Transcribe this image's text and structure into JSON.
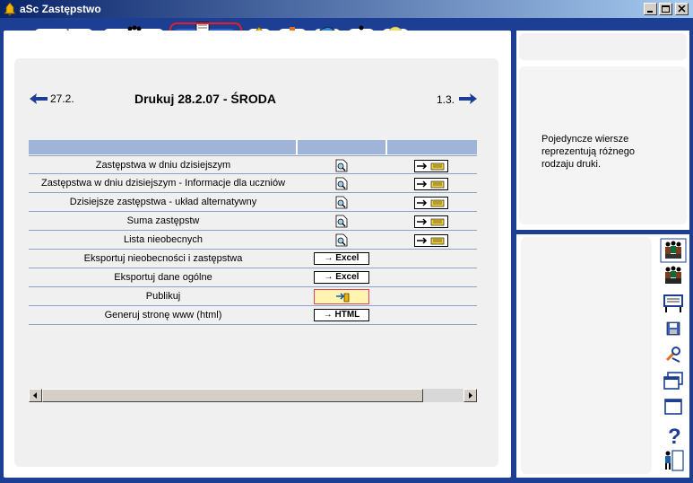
{
  "window": {
    "title": "aSc Zastępstwo"
  },
  "tabs": [
    {
      "name": "sleep",
      "icon": "sleep-icon"
    },
    {
      "name": "teachers",
      "icon": "teachers-icon"
    },
    {
      "name": "print",
      "icon": "printer-icon"
    },
    {
      "name": "bell",
      "icon": "bell-icon"
    },
    {
      "name": "desk",
      "icon": "desk-icon"
    },
    {
      "name": "book",
      "icon": "book-icon"
    },
    {
      "name": "person",
      "icon": "person-icon"
    },
    {
      "name": "cd",
      "icon": "cd-icon"
    }
  ],
  "header": {
    "prev_date": "27.2.",
    "title": "Drukuj 28.2.07 - ŚRODA",
    "next_date": "1.3."
  },
  "rows": [
    {
      "label": "Zastępstwa w dniu dzisiejszym",
      "type": "preview-print"
    },
    {
      "label": "Zastępstwa w dniu dzisiejszym - Informacje dla uczniów",
      "type": "preview-print"
    },
    {
      "label": "Dzisiejsze zastępstwa - układ alternatywny",
      "type": "preview-print"
    },
    {
      "label": "Suma zastępstw",
      "type": "preview-print"
    },
    {
      "label": "Lista nieobecnych",
      "type": "preview-print"
    },
    {
      "label": "Eksportuj nieobecności i zastępstwa",
      "type": "excel",
      "button": "→ Excel"
    },
    {
      "label": "Eksportuj dane ogólne",
      "type": "excel",
      "button": "→ Excel"
    },
    {
      "label": "Publikuj",
      "type": "publish"
    },
    {
      "label": "Generuj stronę www (html)",
      "type": "html",
      "button": "→ HTML"
    }
  ],
  "info": {
    "text": "Pojedyncze wiersze reprezentują różnego rodzaju druki."
  },
  "right_toolbar": [
    "teachers-icon",
    "classes-icon",
    "board-icon",
    "save-icon",
    "tools-icon",
    "windows-icon",
    "window-icon",
    "help-icon",
    "exit-icon"
  ],
  "colors": {
    "frame": "#1c3f94",
    "header_row": "#a0b4d8",
    "highlight": "#e41e26"
  }
}
